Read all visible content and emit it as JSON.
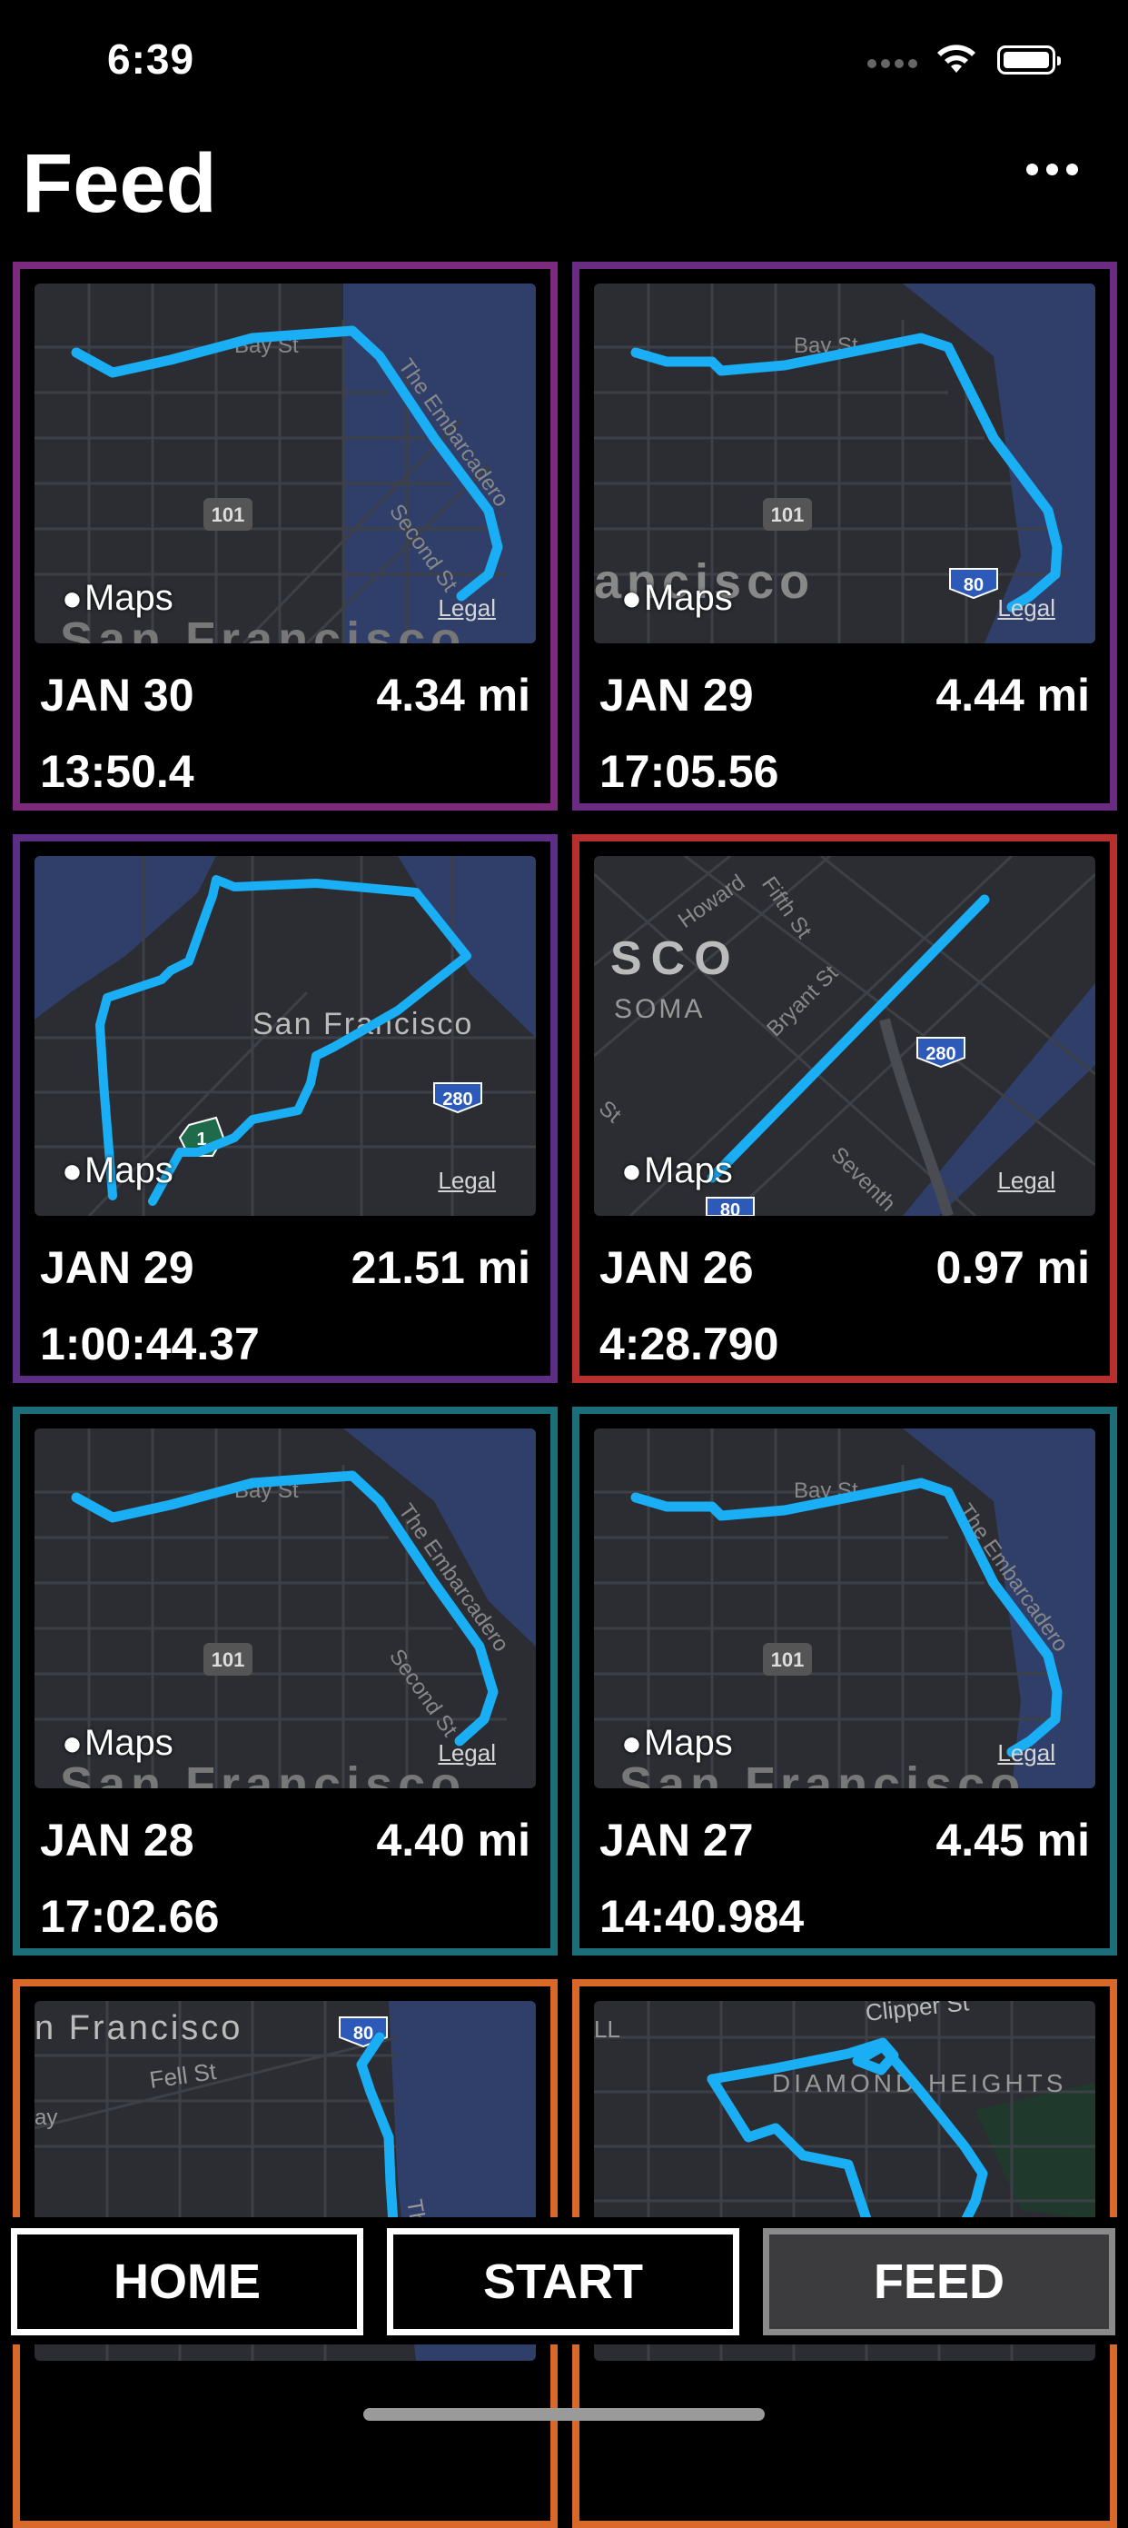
{
  "status_bar": {
    "time": "6:39"
  },
  "header": {
    "title": "Feed"
  },
  "map_labels": {
    "maps": "Maps",
    "legal": "Legal"
  },
  "feed": [
    {
      "date": "JAN 30",
      "distance": "4.34 mi",
      "time": "13:50.4",
      "border_color": "#7b2a7d",
      "street_labels": [
        "Bay St",
        "The Embarcadero",
        "Second St",
        "101",
        "San Francisco"
      ]
    },
    {
      "date": "JAN 29",
      "distance": "4.44 mi",
      "time": "17:05.56",
      "border_color": "#6a2c82",
      "street_labels": [
        "Bay St",
        "101",
        "80",
        "ancisco"
      ]
    },
    {
      "date": "JAN 29",
      "distance": "21.51 mi",
      "time": "1:00:44.37",
      "border_color": "#5d2e86",
      "street_labels": [
        "San Francisco",
        "280",
        "1"
      ]
    },
    {
      "date": "JAN 26",
      "distance": "0.97 mi",
      "time": "4:28.790",
      "border_color": "#b8302e",
      "street_labels": [
        "Howard",
        "Fifth St",
        "Bryant St",
        "SCO",
        "SOMA",
        "280",
        "Seventh",
        "80",
        "St"
      ]
    },
    {
      "date": "JAN 28",
      "distance": "4.40 mi",
      "time": "17:02.66",
      "border_color": "#1c6f78",
      "street_labels": [
        "Bay St",
        "The Embarcadero",
        "Second St",
        "101",
        "San Francisco"
      ]
    },
    {
      "date": "JAN 27",
      "distance": "4.45 mi",
      "time": "14:40.984",
      "border_color": "#1c6f78",
      "street_labels": [
        "Bay St",
        "The Embarcadero",
        "101",
        "San Francisco"
      ]
    },
    {
      "date": "",
      "distance": "",
      "time": "",
      "border_color": "#d9692a",
      "street_labels": [
        "n Francisco",
        "Fell St",
        "80",
        "ay",
        "Thi"
      ]
    },
    {
      "date": "",
      "distance": "",
      "time": "",
      "border_color": "#d9692a",
      "street_labels": [
        "Clipper St",
        "DIAMOND HEIGHTS",
        "LL"
      ]
    }
  ],
  "tabs": [
    {
      "label": "HOME",
      "active": false
    },
    {
      "label": "START",
      "active": false
    },
    {
      "label": "FEED",
      "active": true
    }
  ],
  "colors": {
    "route": "#1aaef4",
    "map_bg": "#2b2d33",
    "water": "#2f3f6a",
    "tab_active": "#3c3c3e"
  }
}
